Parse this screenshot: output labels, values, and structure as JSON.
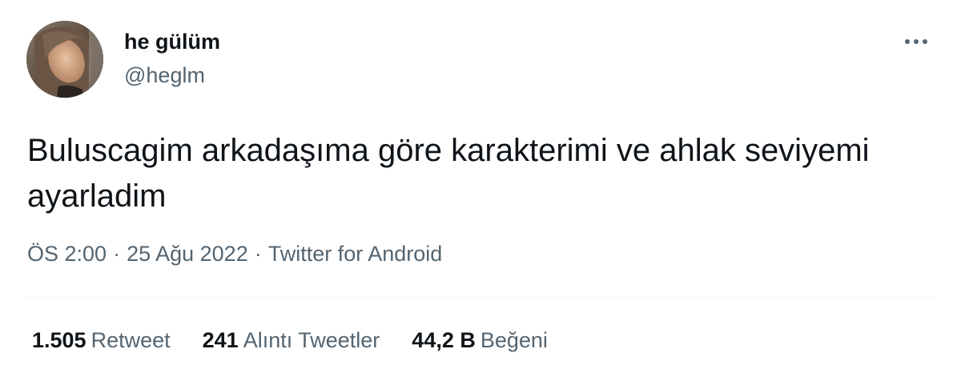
{
  "author": {
    "display_name": "he gülüm",
    "handle": "@heglm"
  },
  "tweet": {
    "text": "Buluscagim arkadaşıma göre karakterimi ve ahlak seviyemi ayarladim"
  },
  "meta": {
    "time": "ÖS 2:00",
    "date": "25 Ağu 2022",
    "source": "Twitter for Android",
    "separator": "·"
  },
  "stats": {
    "retweets": {
      "count": "1.505",
      "label": "Retweet"
    },
    "quotes": {
      "count": "241",
      "label": "Alıntı Tweetler"
    },
    "likes": {
      "count": "44,2 B",
      "label": "Beğeni"
    }
  },
  "icons": {
    "more": "more-horizontal-icon"
  },
  "colors": {
    "text_primary": "#0f1419",
    "text_secondary": "#536471",
    "divider": "#eff3f4",
    "background": "#ffffff"
  }
}
